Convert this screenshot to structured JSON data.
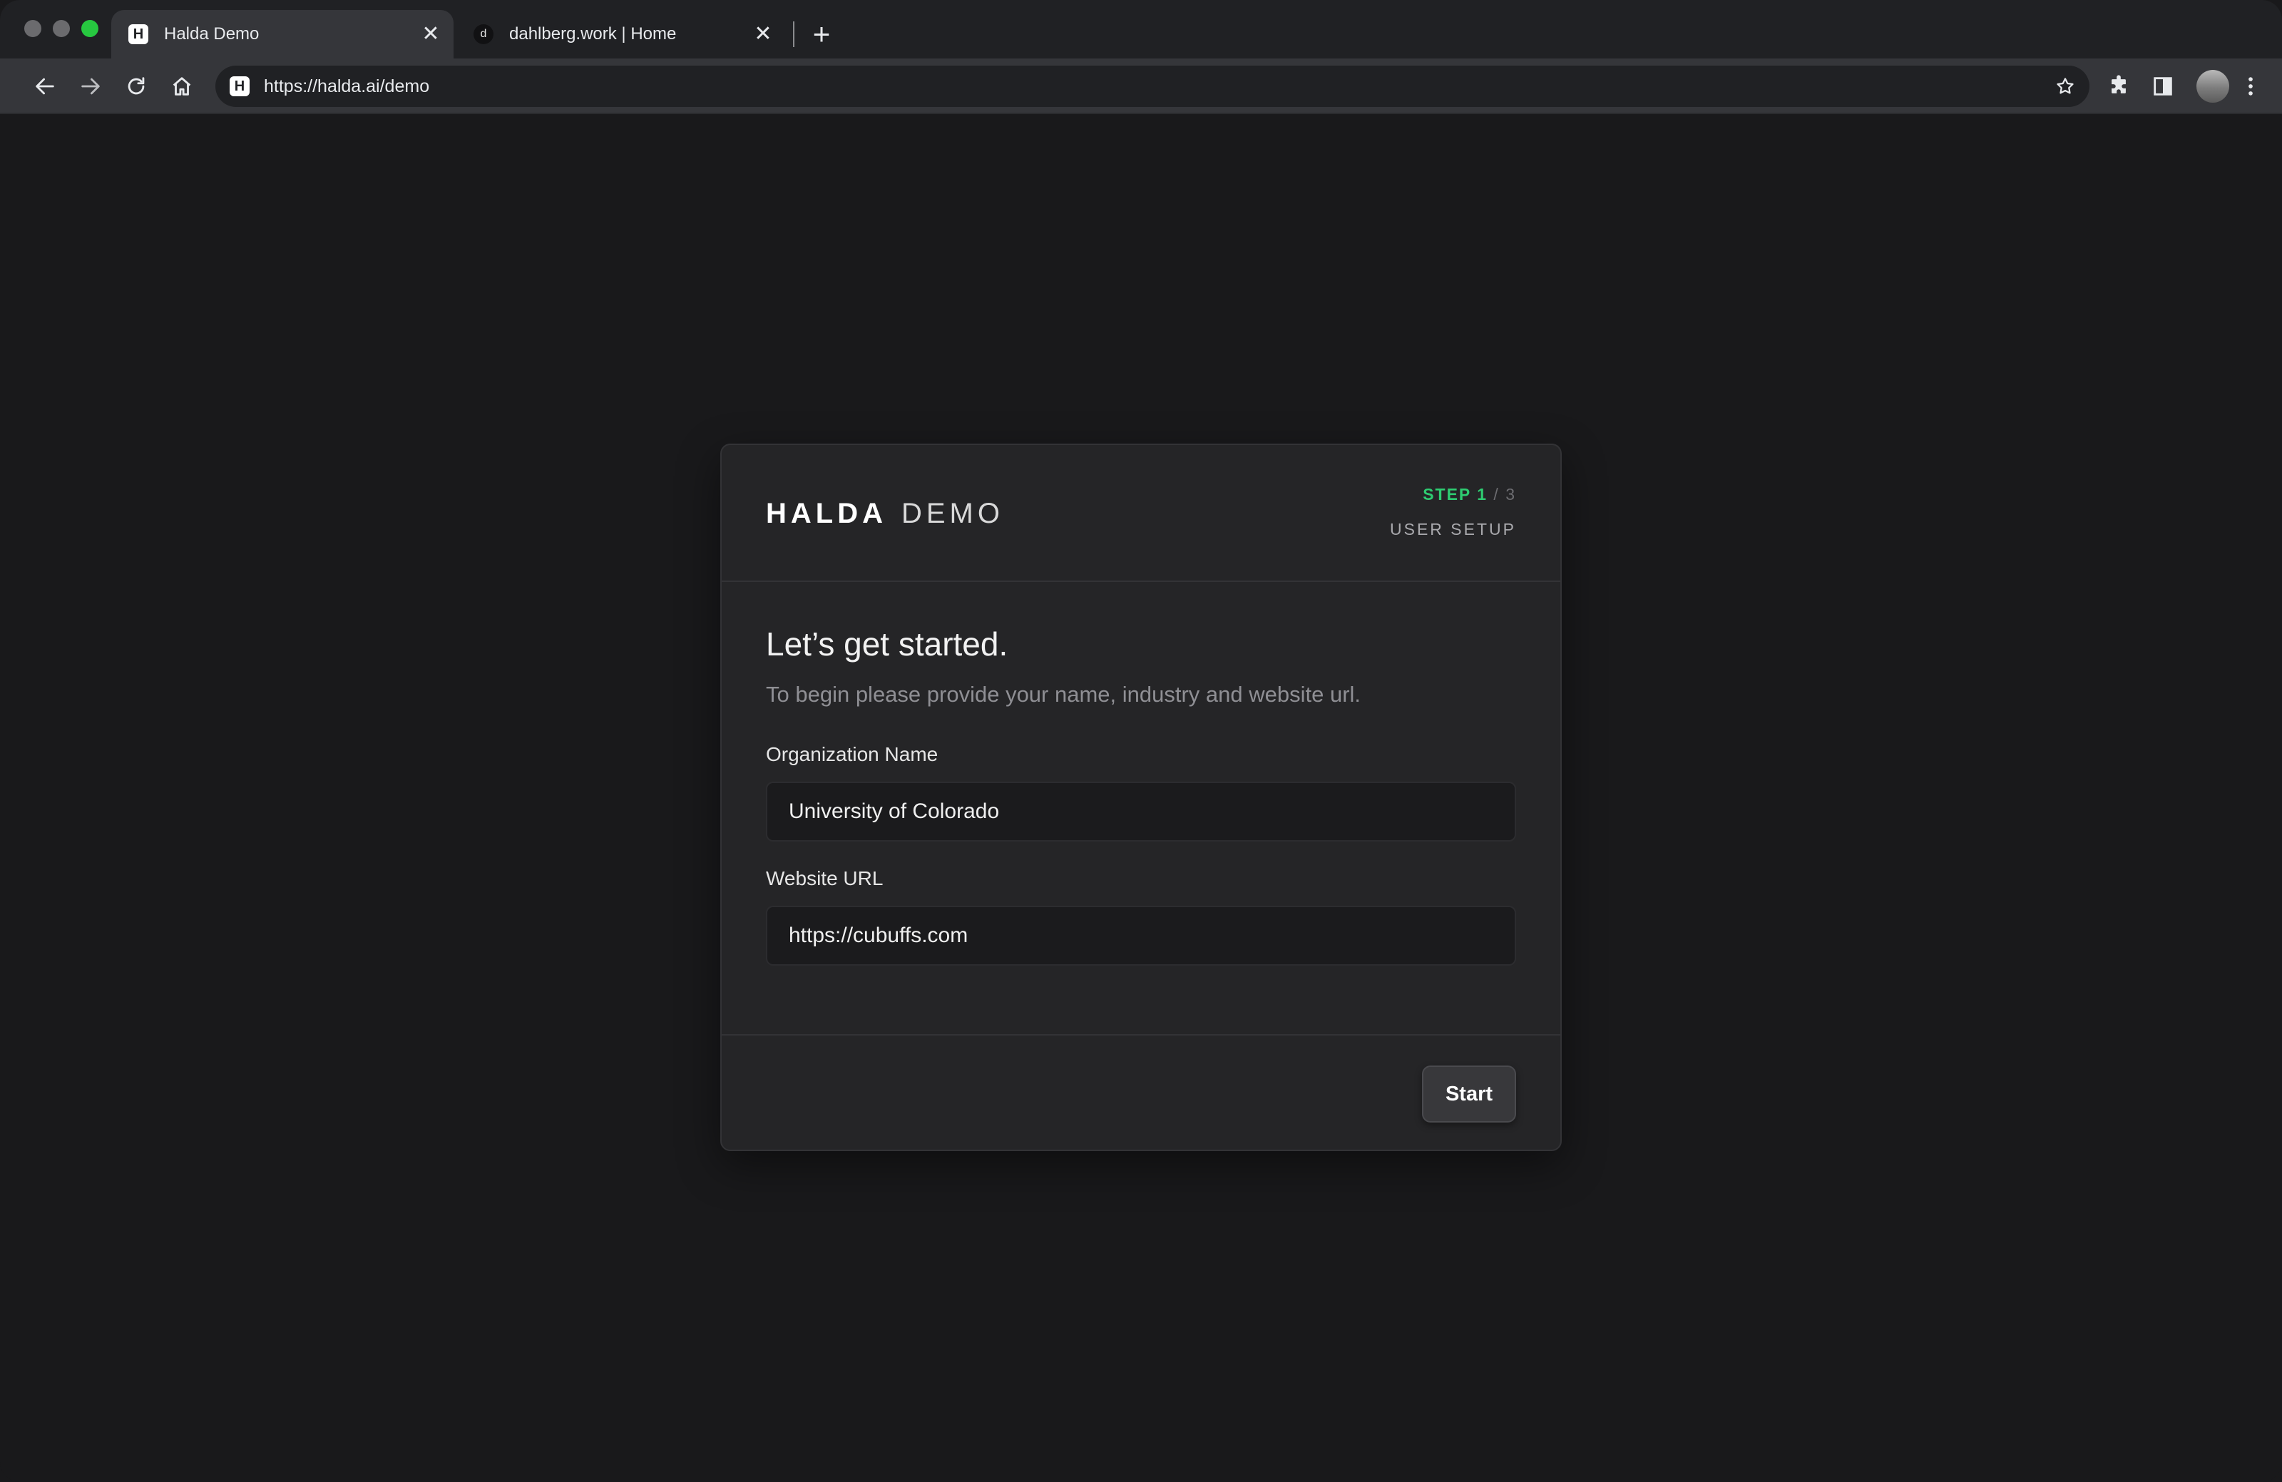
{
  "browser": {
    "tabs": [
      {
        "title": "Halda Demo",
        "favicon": "H",
        "active": true
      },
      {
        "title": "dahlberg.work | Home",
        "favicon": "d",
        "active": false
      }
    ],
    "tab_close_glyph": "✕",
    "new_tab_glyph": "+",
    "address_bar": {
      "url": "https://halda.ai/demo",
      "site_icon": "H"
    },
    "toolbar_icons": [
      "back-arrow-icon",
      "forward-arrow-icon",
      "reload-icon",
      "home-icon",
      "star-icon",
      "puzzle-extension-icon",
      "side-panel-icon",
      "avatar",
      "more-menu-icon"
    ]
  },
  "card": {
    "logo": {
      "brand": "HALDA",
      "suffix": "DEMO"
    },
    "step": {
      "current": "STEP 1",
      "separator_total": " / 3",
      "label": "USER SETUP"
    },
    "heading": "Let’s get started.",
    "subtext": "To begin please provide your name, industry and website url.",
    "fields": {
      "org_name": {
        "label": "Organization Name",
        "value": "University of Colorado"
      },
      "website_url": {
        "label": "Website URL",
        "value": "https://cubuffs.com"
      }
    },
    "start_label": "Start"
  },
  "colors": {
    "page_background": "#19191b",
    "card_background": "#252527",
    "step_accent": "#2ecc71",
    "tab_active": "#35363a",
    "tabstrip": "#202124"
  }
}
